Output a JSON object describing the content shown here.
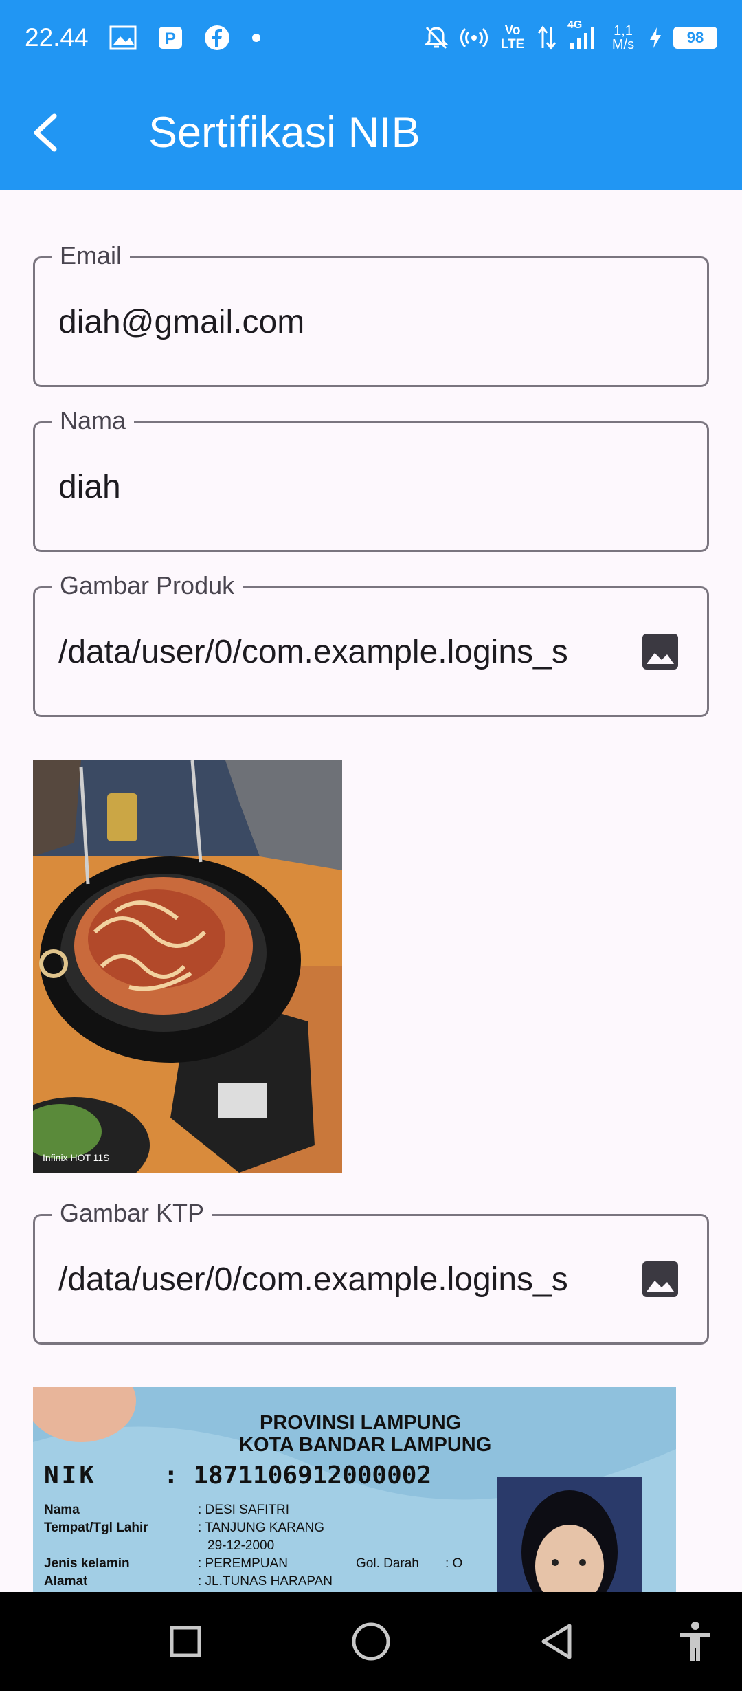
{
  "status_bar": {
    "time": "22.44",
    "network_type": "Vo LTE",
    "network_gen": "4G",
    "speed_value": "1,1",
    "speed_unit": "M/s",
    "battery": "98"
  },
  "app_bar": {
    "title": "Sertifikasi NIB",
    "back_icon": "arrow-back-icon"
  },
  "form": {
    "email": {
      "label": "Email",
      "value": "diah@gmail.com"
    },
    "nama": {
      "label": "Nama",
      "value": "diah"
    },
    "gambar_produk": {
      "label": "Gambar Produk",
      "value": "/data/user/0/com.example.logins_s",
      "icon": "image-icon"
    },
    "gambar_ktp": {
      "label": "Gambar KTP",
      "value": "/data/user/0/com.example.logins_s",
      "icon": "image-icon"
    }
  },
  "photos": {
    "food_watermark": "Infinix HOT 11S",
    "ktp": {
      "province": "PROVINSI LAMPUNG",
      "city": "KOTA BANDAR LAMPUNG",
      "nik_label": "NIK",
      "nik_value": ": 1871106912000002",
      "rows": [
        {
          "label": "Nama",
          "value": ": DESI SAFITRI"
        },
        {
          "label": "Tempat/Tgl Lahir",
          "value": ": TANJUNG KARANG"
        },
        {
          "label": "",
          "value": "29-12-2000"
        },
        {
          "label": "Jenis kelamin",
          "value": ": PEREMPUAN"
        },
        {
          "label": "Alamat",
          "value": ": JL.TUNAS HARAPAN"
        }
      ],
      "blood_label": "Gol. Darah",
      "blood_value": ": O"
    }
  },
  "nav_bar": {
    "recents": "recents-square-icon",
    "home": "home-circle-icon",
    "back": "back-triangle-icon",
    "accessibility": "accessibility-icon"
  },
  "colors": {
    "primary": "#2196f3",
    "background": "#fdf8fd",
    "outline": "#7a757f"
  }
}
